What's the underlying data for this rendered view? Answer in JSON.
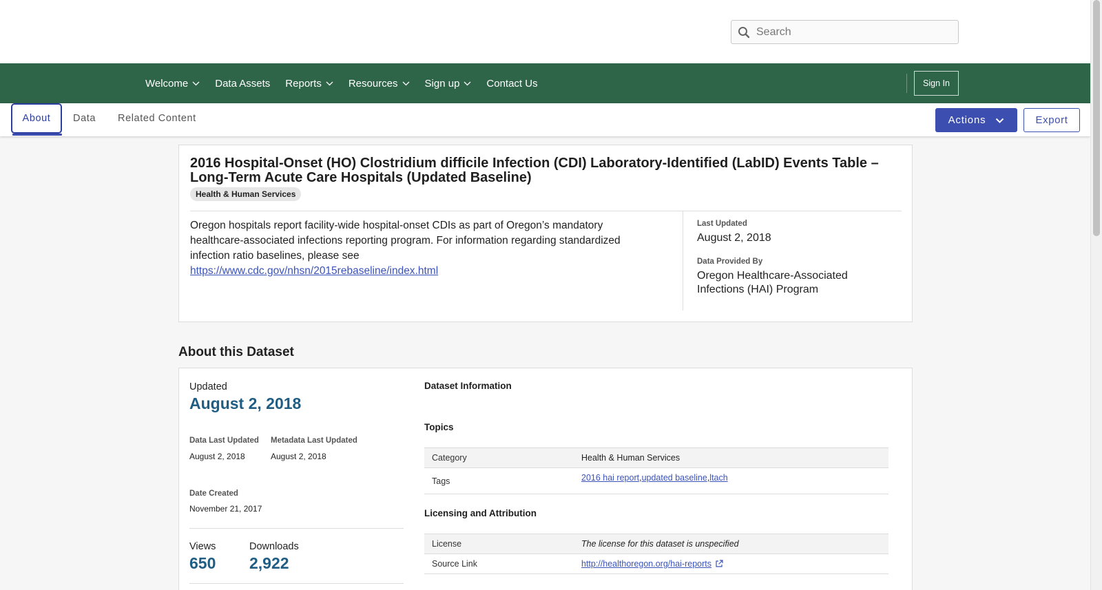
{
  "header": {
    "search_placeholder": "Search"
  },
  "nav": {
    "items": [
      {
        "label": "Welcome",
        "has_dropdown": true
      },
      {
        "label": "Data Assets",
        "has_dropdown": false
      },
      {
        "label": "Reports",
        "has_dropdown": true
      },
      {
        "label": "Resources",
        "has_dropdown": true
      },
      {
        "label": "Sign up",
        "has_dropdown": true
      },
      {
        "label": "Contact Us",
        "has_dropdown": false
      }
    ],
    "sign_in_label": "Sign In"
  },
  "tabs": {
    "items": [
      {
        "label": "About"
      },
      {
        "label": "Data"
      },
      {
        "label": "Related Content"
      }
    ],
    "actions_label": "Actions",
    "export_label": "Export"
  },
  "dataset": {
    "title": "2016 Hospital-Onset (HO) Clostridium difficile Infection (CDI) Laboratory-Identified (LabID) Events Table – Long-Term Acute Care Hospitals (Updated Baseline)",
    "category": "Health & Human Services",
    "description": "Oregon hospitals report facility-wide hospital-onset CDIs as part of Oregon’s mandatory healthcare-associated infections reporting program. For information regarding standardized infection ratio baselines, please see",
    "description_link": "https://www.cdc.gov/nhsn/2015rebaseline/index.html",
    "last_updated_label": "Last Updated",
    "last_updated_value": "August 2, 2018",
    "provided_by_label": "Data Provided By",
    "provided_by_value": "Oregon Healthcare-Associated Infections (HAI) Program"
  },
  "about": {
    "heading": "About this Dataset",
    "updated_label": "Updated",
    "updated_value": "August 2, 2018",
    "data_last_updated_label": "Data Last Updated",
    "data_last_updated_value": "August 2, 2018",
    "metadata_last_updated_label": "Metadata Last Updated",
    "metadata_last_updated_value": "August 2, 2018",
    "date_created_label": "Date Created",
    "date_created_value": "November 21, 2017",
    "views_label": "Views",
    "views_value": "650",
    "downloads_label": "Downloads",
    "downloads_value": "2,922",
    "dataset_info_title": "Dataset Information",
    "topics_title": "Topics",
    "category_key": "Category",
    "category_value": "Health & Human Services",
    "tags_key": "Tags",
    "tags": [
      "2016 hai report",
      "updated baseline",
      "ltach"
    ],
    "licensing_title": "Licensing and Attribution",
    "license_key": "License",
    "license_value": "The license for this dataset is unspecified",
    "source_link_key": "Source Link",
    "source_link_value": "http://healthoregon.org/hai-reports"
  },
  "colors": {
    "nav_green": "#2e6448",
    "primary_blue": "#3c4fb0",
    "stat_blue": "#1f5d84"
  }
}
